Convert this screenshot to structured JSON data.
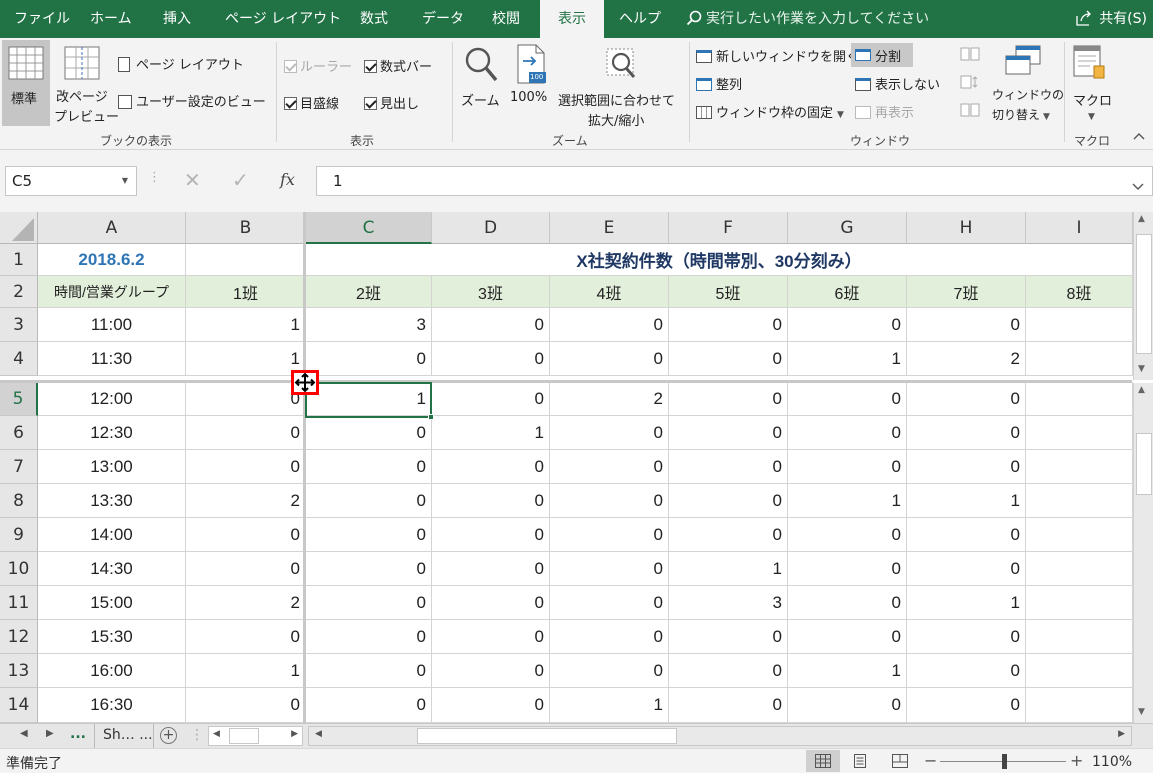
{
  "tabs": [
    {
      "label": "ファイル",
      "active": false
    },
    {
      "label": "ホーム",
      "active": false
    },
    {
      "label": "挿入",
      "active": false
    },
    {
      "label": "ページ レイアウト",
      "active": false
    },
    {
      "label": "数式",
      "active": false
    },
    {
      "label": "データ",
      "active": false
    },
    {
      "label": "校閲",
      "active": false
    },
    {
      "label": "表示",
      "active": true
    },
    {
      "label": "ヘルプ",
      "active": false
    }
  ],
  "tell_me": "実行したい作業を入力してください",
  "share": "共有(S)",
  "ribbon": {
    "book_views": {
      "normal": "標準",
      "page_break_1": "改ページ",
      "page_break_2": "プレビュー",
      "page_layout": "ページ レイアウト",
      "custom_views": "ユーザー設定のビュー",
      "group": "ブックの表示"
    },
    "show": {
      "ruler": "ルーラー",
      "formula_bar": "数式バー",
      "gridlines": "目盛線",
      "headings": "見出し",
      "group": "表示"
    },
    "zoom": {
      "zoom": "ズーム",
      "hundred": "100%",
      "selection_1": "選択範囲に合わせて",
      "selection_2": "拡大/縮小",
      "zoom_level_icon": "100",
      "group": "ズーム"
    },
    "window": {
      "new_window": "新しいウィンドウを開く",
      "arrange": "整列",
      "freeze": "ウィンドウ枠の固定",
      "split": "分割",
      "hide": "表示しない",
      "unhide": "再表示",
      "switch_1": "ウィンドウの",
      "switch_2": "切り替え",
      "group": "ウィンドウ"
    },
    "macros": {
      "macro": "マクロ",
      "group": "マクロ"
    }
  },
  "formula_bar": {
    "name_box": "C5",
    "fx": "fx",
    "value": "1"
  },
  "columns": [
    "A",
    "B",
    "C",
    "D",
    "E",
    "F",
    "G",
    "H",
    "I"
  ],
  "rows": [
    "1",
    "2",
    "3",
    "4",
    "5",
    "6",
    "7",
    "8",
    "9",
    "10",
    "11",
    "12",
    "13",
    "14"
  ],
  "sheet": {
    "a1": "2018.6.2",
    "title": "X社契約件数（時間帯別、30分刻み）",
    "a2": "時間/営業グループ",
    "headers": [
      "1班",
      "2班",
      "3班",
      "4班",
      "5班",
      "6班",
      "7班",
      "8班"
    ],
    "times": [
      "11:00",
      "11:30",
      "12:00",
      "12:30",
      "13:00",
      "13:30",
      "14:00",
      "14:30",
      "15:00",
      "15:30",
      "16:00",
      "16:30"
    ],
    "values": [
      [
        1,
        3,
        0,
        0,
        0,
        0,
        0
      ],
      [
        1,
        0,
        0,
        0,
        0,
        1,
        2
      ],
      [
        0,
        1,
        0,
        2,
        0,
        0,
        0
      ],
      [
        0,
        0,
        1,
        0,
        0,
        0,
        0
      ],
      [
        0,
        0,
        0,
        0,
        0,
        0,
        0
      ],
      [
        2,
        0,
        0,
        0,
        0,
        1,
        1
      ],
      [
        0,
        0,
        0,
        0,
        0,
        0,
        0
      ],
      [
        0,
        0,
        0,
        0,
        1,
        0,
        0
      ],
      [
        2,
        0,
        0,
        0,
        3,
        0,
        1
      ],
      [
        0,
        0,
        0,
        0,
        0,
        0,
        0
      ],
      [
        1,
        0,
        0,
        0,
        0,
        1,
        0
      ],
      [
        0,
        0,
        0,
        1,
        0,
        0,
        0
      ]
    ]
  },
  "sheet_tabs": {
    "ellipsis": "...",
    "tab": "Sh… ..."
  },
  "status": {
    "ready": "準備完了",
    "zoom": "110%"
  },
  "colors": {
    "accent": "#217346",
    "header_fill": "#e2efda",
    "blue_text": "#2e75b6",
    "title_text": "#1f3864",
    "marker": "#ff0000"
  }
}
